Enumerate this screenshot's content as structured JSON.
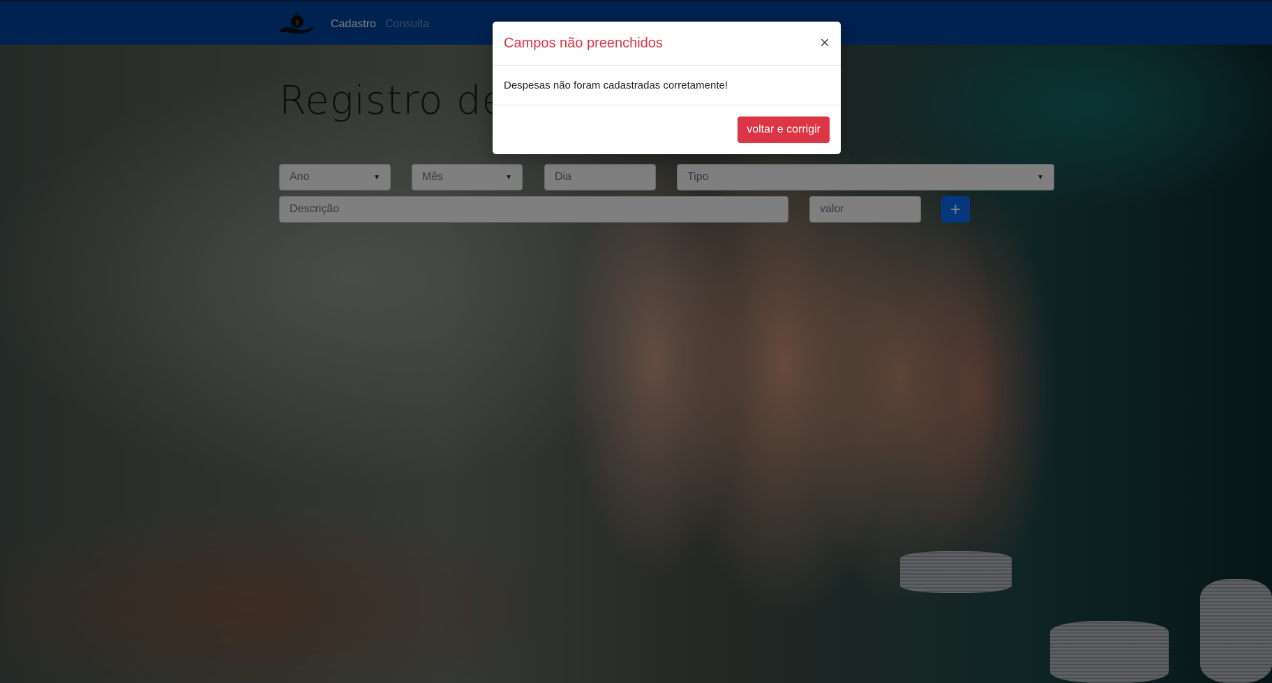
{
  "navbar": {
    "brand_icon": "money-bag-in-hand-icon",
    "links": [
      {
        "label": "Cadastro",
        "active": true
      },
      {
        "label": "Consulta",
        "active": false
      }
    ],
    "color": "#0044a0"
  },
  "main": {
    "title": "Registro de n",
    "form": {
      "ano_placeholder": "Ano",
      "mes_placeholder": "Mês",
      "dia_placeholder": "Dia",
      "tipo_placeholder": "Tipo",
      "descricao_placeholder": "Descrição",
      "valor_placeholder": "valor",
      "add_label": "+"
    }
  },
  "modal": {
    "title": "Campos não preenchidos",
    "close_label": "×",
    "body": "Despesas não foram cadastradas corretamente!",
    "action_label": "voltar e corrigir",
    "title_color": "#dc3545",
    "action_color": "#dc3545"
  }
}
